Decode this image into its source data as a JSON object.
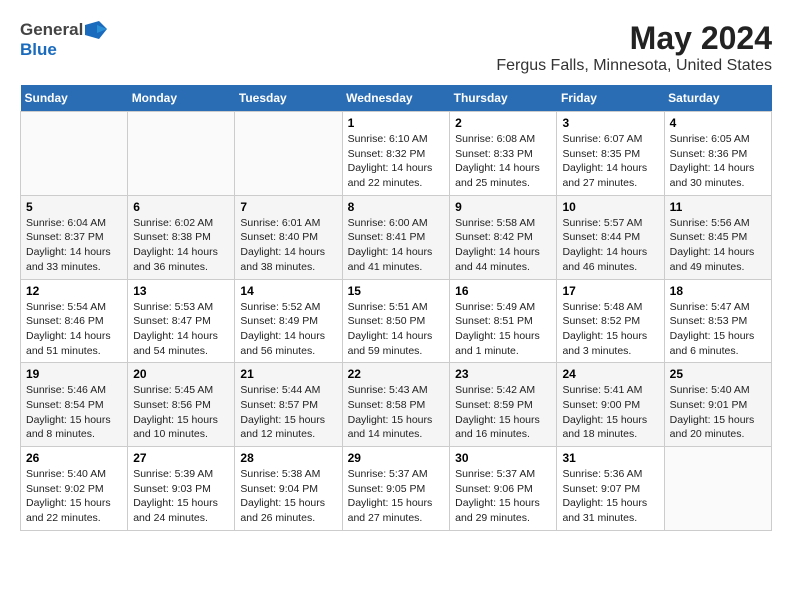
{
  "header": {
    "logo_general": "General",
    "logo_blue": "Blue",
    "title": "May 2024",
    "subtitle": "Fergus Falls, Minnesota, United States"
  },
  "days_of_week": [
    "Sunday",
    "Monday",
    "Tuesday",
    "Wednesday",
    "Thursday",
    "Friday",
    "Saturday"
  ],
  "weeks": [
    {
      "cells": [
        {
          "day": "",
          "content": ""
        },
        {
          "day": "",
          "content": ""
        },
        {
          "day": "",
          "content": ""
        },
        {
          "day": "1",
          "content": "Sunrise: 6:10 AM\nSunset: 8:32 PM\nDaylight: 14 hours\nand 22 minutes."
        },
        {
          "day": "2",
          "content": "Sunrise: 6:08 AM\nSunset: 8:33 PM\nDaylight: 14 hours\nand 25 minutes."
        },
        {
          "day": "3",
          "content": "Sunrise: 6:07 AM\nSunset: 8:35 PM\nDaylight: 14 hours\nand 27 minutes."
        },
        {
          "day": "4",
          "content": "Sunrise: 6:05 AM\nSunset: 8:36 PM\nDaylight: 14 hours\nand 30 minutes."
        }
      ]
    },
    {
      "cells": [
        {
          "day": "5",
          "content": "Sunrise: 6:04 AM\nSunset: 8:37 PM\nDaylight: 14 hours\nand 33 minutes."
        },
        {
          "day": "6",
          "content": "Sunrise: 6:02 AM\nSunset: 8:38 PM\nDaylight: 14 hours\nand 36 minutes."
        },
        {
          "day": "7",
          "content": "Sunrise: 6:01 AM\nSunset: 8:40 PM\nDaylight: 14 hours\nand 38 minutes."
        },
        {
          "day": "8",
          "content": "Sunrise: 6:00 AM\nSunset: 8:41 PM\nDaylight: 14 hours\nand 41 minutes."
        },
        {
          "day": "9",
          "content": "Sunrise: 5:58 AM\nSunset: 8:42 PM\nDaylight: 14 hours\nand 44 minutes."
        },
        {
          "day": "10",
          "content": "Sunrise: 5:57 AM\nSunset: 8:44 PM\nDaylight: 14 hours\nand 46 minutes."
        },
        {
          "day": "11",
          "content": "Sunrise: 5:56 AM\nSunset: 8:45 PM\nDaylight: 14 hours\nand 49 minutes."
        }
      ]
    },
    {
      "cells": [
        {
          "day": "12",
          "content": "Sunrise: 5:54 AM\nSunset: 8:46 PM\nDaylight: 14 hours\nand 51 minutes."
        },
        {
          "day": "13",
          "content": "Sunrise: 5:53 AM\nSunset: 8:47 PM\nDaylight: 14 hours\nand 54 minutes."
        },
        {
          "day": "14",
          "content": "Sunrise: 5:52 AM\nSunset: 8:49 PM\nDaylight: 14 hours\nand 56 minutes."
        },
        {
          "day": "15",
          "content": "Sunrise: 5:51 AM\nSunset: 8:50 PM\nDaylight: 14 hours\nand 59 minutes."
        },
        {
          "day": "16",
          "content": "Sunrise: 5:49 AM\nSunset: 8:51 PM\nDaylight: 15 hours\nand 1 minute."
        },
        {
          "day": "17",
          "content": "Sunrise: 5:48 AM\nSunset: 8:52 PM\nDaylight: 15 hours\nand 3 minutes."
        },
        {
          "day": "18",
          "content": "Sunrise: 5:47 AM\nSunset: 8:53 PM\nDaylight: 15 hours\nand 6 minutes."
        }
      ]
    },
    {
      "cells": [
        {
          "day": "19",
          "content": "Sunrise: 5:46 AM\nSunset: 8:54 PM\nDaylight: 15 hours\nand 8 minutes."
        },
        {
          "day": "20",
          "content": "Sunrise: 5:45 AM\nSunset: 8:56 PM\nDaylight: 15 hours\nand 10 minutes."
        },
        {
          "day": "21",
          "content": "Sunrise: 5:44 AM\nSunset: 8:57 PM\nDaylight: 15 hours\nand 12 minutes."
        },
        {
          "day": "22",
          "content": "Sunrise: 5:43 AM\nSunset: 8:58 PM\nDaylight: 15 hours\nand 14 minutes."
        },
        {
          "day": "23",
          "content": "Sunrise: 5:42 AM\nSunset: 8:59 PM\nDaylight: 15 hours\nand 16 minutes."
        },
        {
          "day": "24",
          "content": "Sunrise: 5:41 AM\nSunset: 9:00 PM\nDaylight: 15 hours\nand 18 minutes."
        },
        {
          "day": "25",
          "content": "Sunrise: 5:40 AM\nSunset: 9:01 PM\nDaylight: 15 hours\nand 20 minutes."
        }
      ]
    },
    {
      "cells": [
        {
          "day": "26",
          "content": "Sunrise: 5:40 AM\nSunset: 9:02 PM\nDaylight: 15 hours\nand 22 minutes."
        },
        {
          "day": "27",
          "content": "Sunrise: 5:39 AM\nSunset: 9:03 PM\nDaylight: 15 hours\nand 24 minutes."
        },
        {
          "day": "28",
          "content": "Sunrise: 5:38 AM\nSunset: 9:04 PM\nDaylight: 15 hours\nand 26 minutes."
        },
        {
          "day": "29",
          "content": "Sunrise: 5:37 AM\nSunset: 9:05 PM\nDaylight: 15 hours\nand 27 minutes."
        },
        {
          "day": "30",
          "content": "Sunrise: 5:37 AM\nSunset: 9:06 PM\nDaylight: 15 hours\nand 29 minutes."
        },
        {
          "day": "31",
          "content": "Sunrise: 5:36 AM\nSunset: 9:07 PM\nDaylight: 15 hours\nand 31 minutes."
        },
        {
          "day": "",
          "content": ""
        }
      ]
    }
  ]
}
